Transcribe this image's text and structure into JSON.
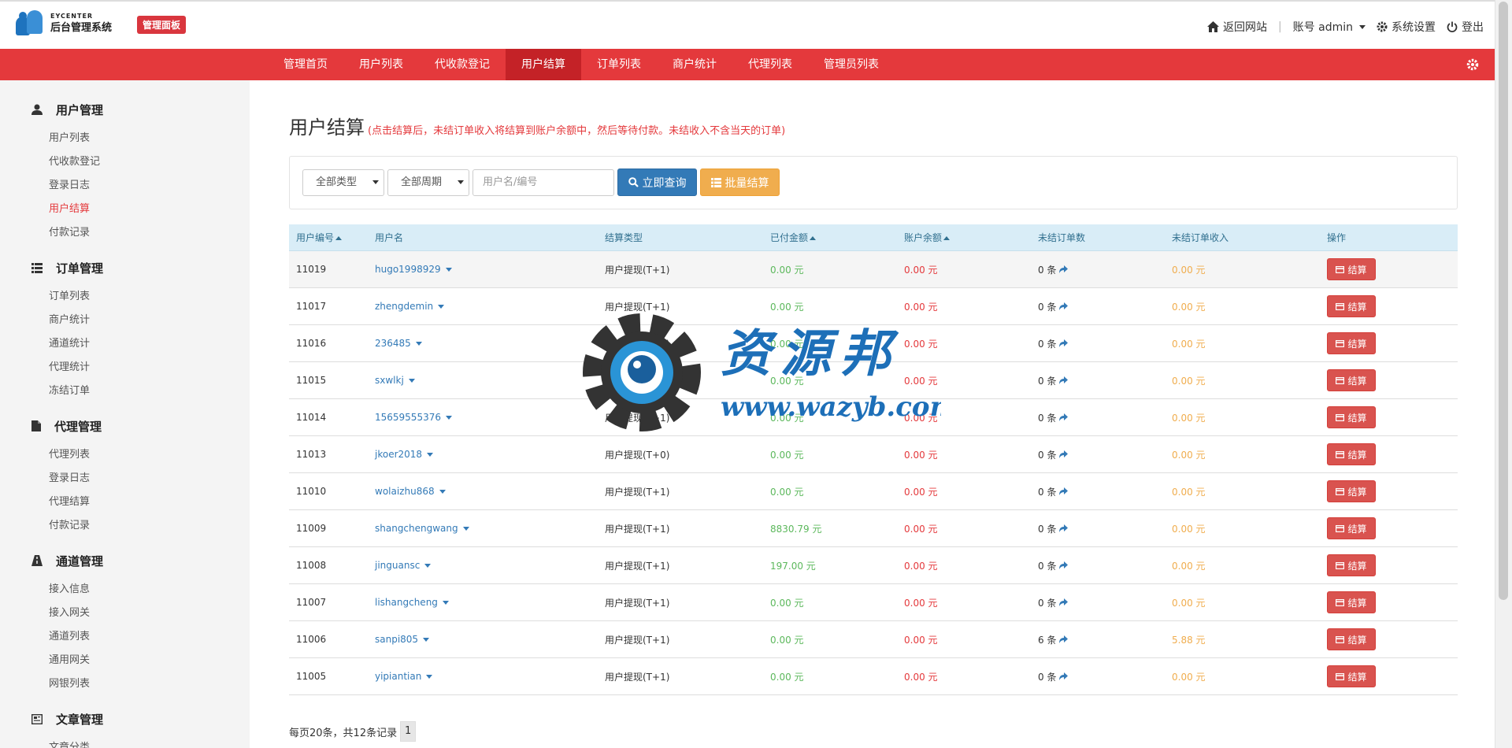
{
  "header": {
    "logo_en": "EYCENTER",
    "logo_cn": "后台管理系统",
    "badge": "管理面板",
    "back_site": "返回网站",
    "account": "账号 admin",
    "settings": "系统设置",
    "logout": "登出"
  },
  "nav": {
    "items": [
      "管理首页",
      "用户列表",
      "代收款登记",
      "用户结算",
      "订单列表",
      "商户统计",
      "代理列表",
      "管理员列表"
    ],
    "active_index": 3
  },
  "sidebar": {
    "groups": [
      {
        "title": "用户管理",
        "icon": "user-icon",
        "items": [
          "用户列表",
          "代收款登记",
          "登录日志",
          "用户结算",
          "付款记录"
        ]
      },
      {
        "title": "订单管理",
        "icon": "list-icon",
        "items": [
          "订单列表",
          "商户统计",
          "通道统计",
          "代理统计",
          "冻结订单"
        ]
      },
      {
        "title": "代理管理",
        "icon": "file-icon",
        "items": [
          "代理列表",
          "登录日志",
          "代理结算",
          "付款记录"
        ]
      },
      {
        "title": "通道管理",
        "icon": "road-icon",
        "items": [
          "接入信息",
          "接入网关",
          "通道列表",
          "通用网关",
          "网银列表"
        ]
      },
      {
        "title": "文章管理",
        "icon": "news-icon",
        "items": [
          "文章分类"
        ]
      }
    ],
    "active_item": "用户结算"
  },
  "page": {
    "title": "用户结算",
    "note": "(点击结算后，未结订单收入将结算到账户余额中，然后等待付款。未结收入不含当天的订单)"
  },
  "filters": {
    "type_select": "全部类型",
    "period_select": "全部周期",
    "search_placeholder": "用户名/编号",
    "query_button": "立即查询",
    "batch_button": "批量结算"
  },
  "table": {
    "headers": [
      "用户编号",
      "用户名",
      "结算类型",
      "已付金额",
      "账户余额",
      "未结订单数",
      "未结订单收入",
      "操作"
    ],
    "settle_label": "结算",
    "rows": [
      {
        "id": "11019",
        "name": "hugo1998929",
        "type": "用户提现(T+1)",
        "paid": "0.00 元",
        "balance": "0.00 元",
        "count": "0 条",
        "income": "0.00 元"
      },
      {
        "id": "11017",
        "name": "zhengdemin",
        "type": "用户提现(T+1)",
        "paid": "0.00 元",
        "balance": "0.00 元",
        "count": "0 条",
        "income": "0.00 元"
      },
      {
        "id": "11016",
        "name": "236485",
        "type": "用户提现(T+1)",
        "paid": "0.00 元",
        "balance": "0.00 元",
        "count": "0 条",
        "income": "0.00 元"
      },
      {
        "id": "11015",
        "name": "sxwlkj",
        "type": "用户提现(T+1)",
        "paid": "0.00 元",
        "balance": "0.00 元",
        "count": "0 条",
        "income": "0.00 元"
      },
      {
        "id": "11014",
        "name": "15659555376",
        "type": "用户提现(T+1)",
        "paid": "0.00 元",
        "balance": "0.00 元",
        "count": "0 条",
        "income": "0.00 元"
      },
      {
        "id": "11013",
        "name": "jkoer2018",
        "type": "用户提现(T+0)",
        "paid": "0.00 元",
        "balance": "0.00 元",
        "count": "0 条",
        "income": "0.00 元"
      },
      {
        "id": "11010",
        "name": "wolaizhu868",
        "type": "用户提现(T+1)",
        "paid": "0.00 元",
        "balance": "0.00 元",
        "count": "0 条",
        "income": "0.00 元"
      },
      {
        "id": "11009",
        "name": "shangchengwang",
        "type": "用户提现(T+1)",
        "paid": "8830.79 元",
        "balance": "0.00 元",
        "count": "0 条",
        "income": "0.00 元"
      },
      {
        "id": "11008",
        "name": "jinguansc",
        "type": "用户提现(T+1)",
        "paid": "197.00 元",
        "balance": "0.00 元",
        "count": "0 条",
        "income": "0.00 元"
      },
      {
        "id": "11007",
        "name": "lishangcheng",
        "type": "用户提现(T+1)",
        "paid": "0.00 元",
        "balance": "0.00 元",
        "count": "0 条",
        "income": "0.00 元"
      },
      {
        "id": "11006",
        "name": "sanpi805",
        "type": "用户提现(T+1)",
        "paid": "0.00 元",
        "balance": "0.00 元",
        "count": "6 条",
        "income": "5.88 元"
      },
      {
        "id": "11005",
        "name": "yipiantian",
        "type": "用户提现(T+1)",
        "paid": "0.00 元",
        "balance": "0.00 元",
        "count": "0 条",
        "income": "0.00 元"
      }
    ]
  },
  "pager": {
    "summary": "每页20条，共12条记录",
    "current": "1"
  },
  "watermark": {
    "text_cn": "资源邦",
    "text_url": "www.wazyb.com"
  },
  "colors": {
    "brand_red": "#e4393c",
    "primary_blue": "#337ab7",
    "warning_orange": "#f0ad4e",
    "success_green": "#5cb85c"
  }
}
